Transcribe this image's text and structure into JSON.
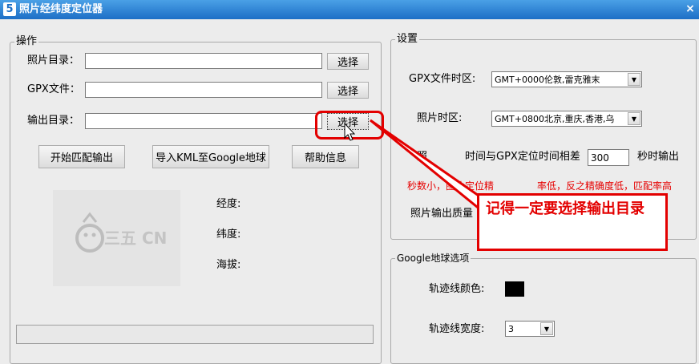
{
  "window": {
    "title": "照片经纬度定位器",
    "icon_glyph": "5",
    "close_glyph": "×"
  },
  "operation": {
    "legend": "操作",
    "photo_dir_label": "照片目录：",
    "gpx_file_label": "GPX文件：",
    "output_dir_label": "输出目录：",
    "photo_dir_value": "",
    "gpx_file_value": "",
    "output_dir_value": "",
    "choose_label": "选择",
    "start_button": "开始匹配输出",
    "export_kml_button": "导入KML至Google地球",
    "help_button": "帮助信息",
    "longitude_label": "经度:",
    "latitude_label": "纬度:",
    "altitude_label": "海拔:",
    "logo_text": "三五 CN"
  },
  "settings": {
    "legend": "设置",
    "gpx_tz_label": "GPX文件时区:",
    "gpx_tz_value": "GMT+0000伦敦,雷克雅末",
    "photo_tz_label": "照片时区:",
    "photo_tz_value": "GMT+0800北京,重庆,香港,乌",
    "diff_label_a": "照",
    "diff_label_b": "时间与GPX定位时间相差",
    "diff_value": "300",
    "diff_suffix": "秒时输出",
    "hint_a": "秒数小，图片定位精",
    "hint_b": "率低，反之精确度低，匹配率高",
    "quality_label": "照片输出质量"
  },
  "google": {
    "legend": "Google地球选项",
    "track_color_label": "轨迹线颜色:",
    "track_color": "#000000",
    "track_width_label": "轨迹线宽度:",
    "track_width_value": "3"
  },
  "annotation": {
    "text": "记得一定要选择输出目录",
    "color": "#e30000"
  }
}
